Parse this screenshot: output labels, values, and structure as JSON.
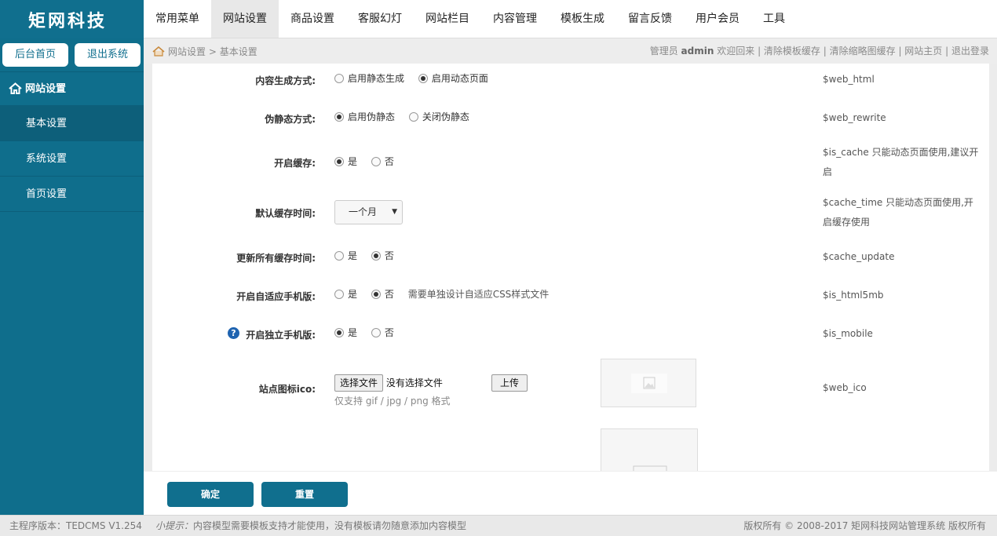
{
  "logo": "矩网科技",
  "topnav": [
    "常用菜单",
    "网站设置",
    "商品设置",
    "客服幻灯",
    "网站栏目",
    "内容管理",
    "模板生成",
    "留言反馈",
    "用户会员",
    "工具"
  ],
  "sidebar": {
    "home_btn": "后台首页",
    "logout_btn": "退出系统",
    "section": "网站设置",
    "items": [
      "基本设置",
      "系统设置",
      "首页设置"
    ]
  },
  "breadcrumb": {
    "root": "网站设置",
    "sep": ">",
    "current": "基本设置"
  },
  "toplinks": {
    "admin_prefix": "管理员",
    "admin_name": "admin",
    "welcome": "欢迎回来",
    "links": [
      "清除模板缓存",
      "清除缩略图缓存",
      "网站主页",
      "退出登录"
    ]
  },
  "form": {
    "content_mode": {
      "label": "内容生成方式:",
      "opt1": "启用静态生成",
      "opt2": "启用动态页面",
      "var": "$web_html"
    },
    "rewrite": {
      "label": "伪静态方式:",
      "opt1": "启用伪静态",
      "opt2": "关闭伪静态",
      "var": "$web_rewrite"
    },
    "cache": {
      "label": "开启缓存:",
      "opt1": "是",
      "opt2": "否",
      "var": "$is_cache 只能动态页面使用,建议开启"
    },
    "cache_time": {
      "label": "默认缓存时间:",
      "value": "一个月",
      "var": "$cache_time 只能动态页面使用,开启缓存使用"
    },
    "cache_update": {
      "label": "更新所有缓存时间:",
      "opt1": "是",
      "opt2": "否",
      "var": "$cache_update"
    },
    "html5mb": {
      "label": "开启自适应手机版:",
      "opt1": "是",
      "opt2": "否",
      "note": "需要单独设计自适应CSS样式文件",
      "var": "$is_html5mb"
    },
    "mobile": {
      "label": "开启独立手机版:",
      "opt1": "是",
      "opt2": "否",
      "var": "$is_mobile",
      "help": "?"
    },
    "ico": {
      "label": "站点图标ico:",
      "choose": "选择文件",
      "no_file": "没有选择文件",
      "upload": "上传",
      "hint": "仅支持 gif / jpg / png 格式",
      "var": "$web_ico"
    }
  },
  "buttons": {
    "ok": "确定",
    "reset": "重置"
  },
  "footer": {
    "version": "主程序版本：TEDCMS V1.254",
    "tip_prefix": "小提示：",
    "tip": "内容模型需要模板支持才能使用，没有模板请勿随意添加内容模型",
    "copyright": "版权所有 © 2008-2017 矩网科技网站管理系统 版权所有"
  },
  "colors": {
    "brand": "#106f8e",
    "sidebar": "#0f6e8c",
    "help": "#1e63b0"
  }
}
